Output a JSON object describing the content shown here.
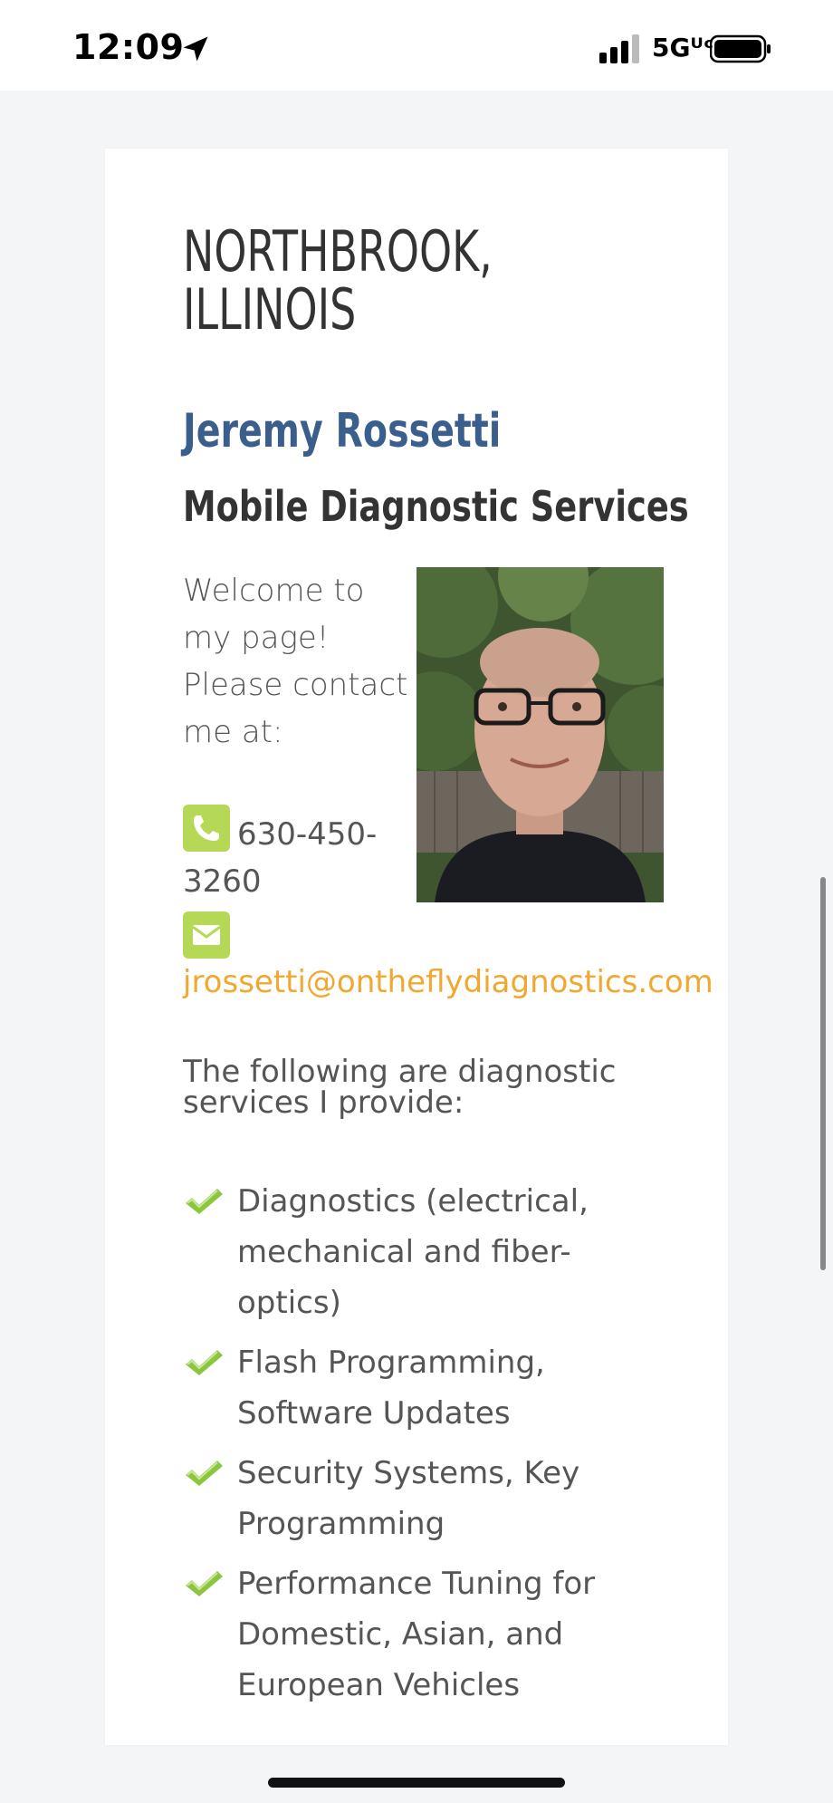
{
  "status_bar": {
    "time": "12:09",
    "network": "5Gᵁᶜ",
    "icons": [
      "location-arrow-icon",
      "signal-bars-icon",
      "battery-icon"
    ]
  },
  "page": {
    "heading": "NORTHBROOK, ILLINOIS",
    "name": "Jeremy Rossetti",
    "subtitle": "Mobile Diagnostic Services",
    "welcome": "Welcome to my page! Please contact me at:",
    "phone": "630-450-3260",
    "email": "jrossetti@ontheflydiagnostics.com",
    "intro": "The following are diagnostic services I provide:",
    "services": [
      "Diagnostics (electrical, mechanical and fiber-optics)",
      "Flash Programming, Software Updates",
      "Security Systems, Key Programming",
      "Performance Tuning for Domestic, Asian, and European Vehicles"
    ]
  },
  "colors": {
    "name": "#3b5f8c",
    "email": "#f0a830",
    "icon_bg": "#b5d957",
    "check": "#8cc63f"
  }
}
